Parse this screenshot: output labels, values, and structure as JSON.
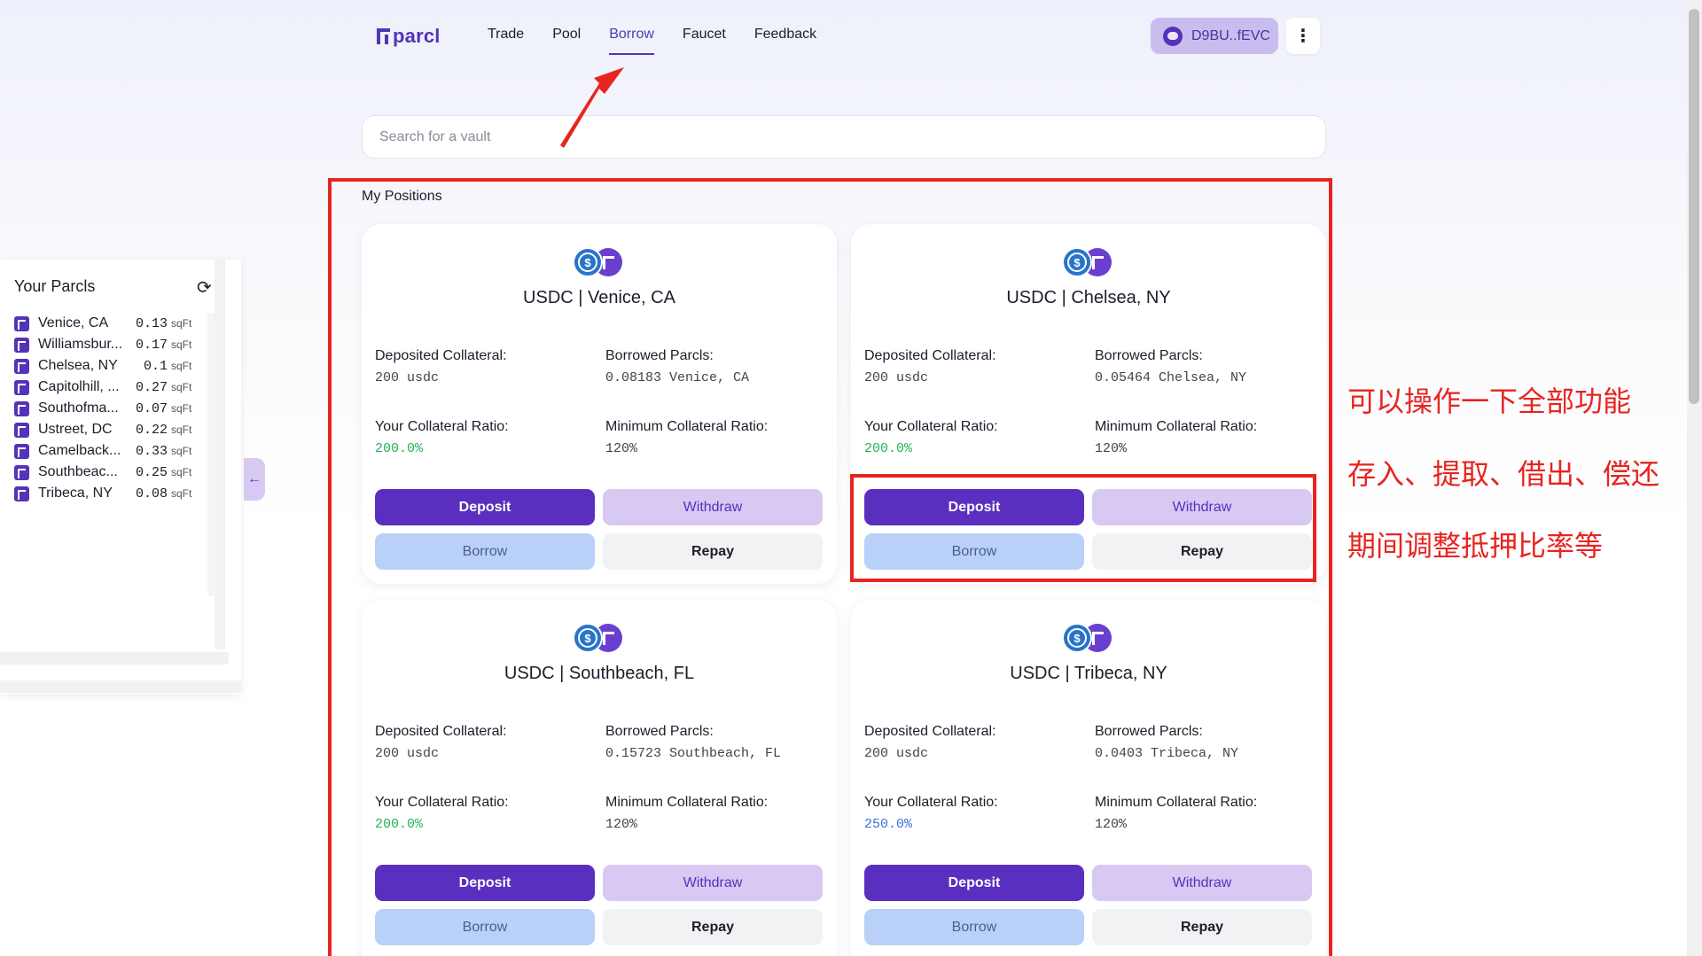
{
  "brand": {
    "logo_text": "parcl",
    "accent": "#5433b8"
  },
  "nav": {
    "items": [
      {
        "label": "Trade",
        "active": false
      },
      {
        "label": "Pool",
        "active": false
      },
      {
        "label": "Borrow",
        "active": true
      },
      {
        "label": "Faucet",
        "active": false
      },
      {
        "label": "Feedback",
        "active": false
      }
    ]
  },
  "wallet": {
    "address": "D9BU..fEVC",
    "icon": "wallet-icon"
  },
  "menu": {
    "icon": "kebab-menu-icon"
  },
  "search": {
    "placeholder": "Search for a vault",
    "value": ""
  },
  "annotations": {
    "line1": "可以操作一下全部功能",
    "line2": "存入、提取、借出、偿还",
    "line3": "期间调整抵押比率等",
    "color": "#e8241f"
  },
  "positions": {
    "title": "My Positions",
    "labels": {
      "deposited": "Deposited Collateral:",
      "borrowed": "Borrowed Parcls:",
      "your_ratio": "Your Collateral Ratio:",
      "min_ratio": "Minimum Collateral Ratio:"
    },
    "buttons": {
      "deposit": "Deposit",
      "withdraw": "Withdraw",
      "borrow": "Borrow",
      "repay": "Repay"
    },
    "cards": [
      {
        "title": "USDC | Venice, CA",
        "deposited": "200 usdc",
        "borrowed": "0.08183 Venice, CA",
        "your_ratio": "200.0%",
        "ratio_color": "green",
        "min_ratio": "120%"
      },
      {
        "title": "USDC | Chelsea, NY",
        "deposited": "200 usdc",
        "borrowed": "0.05464 Chelsea, NY",
        "your_ratio": "200.0%",
        "ratio_color": "green",
        "min_ratio": "120%"
      },
      {
        "title": "USDC | Southbeach, FL",
        "deposited": "200 usdc",
        "borrowed": "0.15723 Southbeach, FL",
        "your_ratio": "200.0%",
        "ratio_color": "green",
        "min_ratio": "120%"
      },
      {
        "title": "USDC | Tribeca, NY",
        "deposited": "200 usdc",
        "borrowed": "0.0403 Tribeca, NY",
        "your_ratio": "250.0%",
        "ratio_color": "blue",
        "min_ratio": "120%"
      }
    ]
  },
  "sidebar": {
    "title": "Your Parcls",
    "refresh_icon": "refresh-icon",
    "unit": "sqFt",
    "items": [
      {
        "name": "Venice, CA",
        "amount": "0.13"
      },
      {
        "name": "Williamsbur...",
        "amount": "0.17"
      },
      {
        "name": "Chelsea, NY",
        "amount": "0.1"
      },
      {
        "name": "Capitolhill, ...",
        "amount": "0.27"
      },
      {
        "name": "Southofma...",
        "amount": "0.07"
      },
      {
        "name": "Ustreet, DC",
        "amount": "0.22"
      },
      {
        "name": "Camelback...",
        "amount": "0.33"
      },
      {
        "name": "Southbeac...",
        "amount": "0.25"
      },
      {
        "name": "Tribeca, NY",
        "amount": "0.08"
      }
    ],
    "collapse_icon": "arrow-left-icon"
  }
}
